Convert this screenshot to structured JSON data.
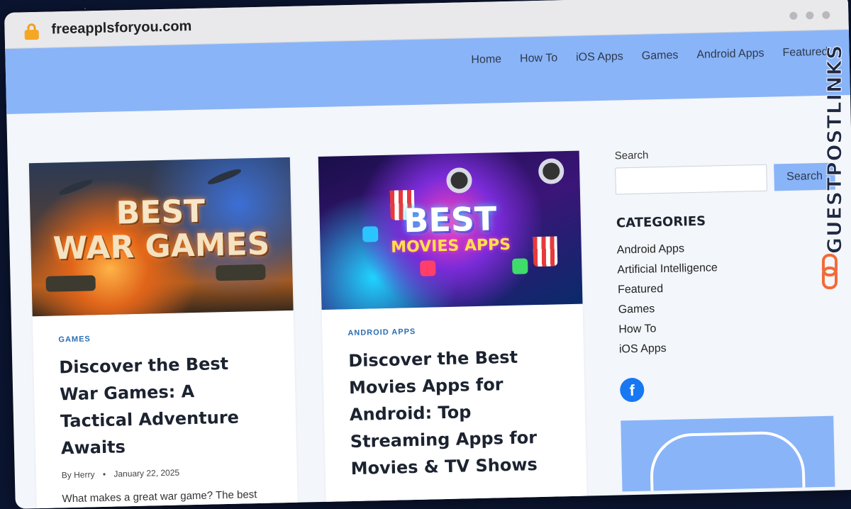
{
  "browser": {
    "url": "freeapplsforyou.com"
  },
  "nav": {
    "items": [
      "Home",
      "How To",
      "iOS Apps",
      "Games",
      "Android Apps",
      "Featured"
    ]
  },
  "posts": [
    {
      "image_text_line1": "BEST",
      "image_text_line2": "WAR GAMES",
      "category": "GAMES",
      "title": "Discover the Best War Games: A Tactical Adventure Awaits",
      "author_prefix": "By",
      "author": "Herry",
      "date": "January 22, 2025",
      "excerpt": "What makes a great war game? The best"
    },
    {
      "image_text_line1": "BEST",
      "image_text_line2": "MOVIES APPS",
      "category": "ANDROID APPS",
      "title": "Discover the Best Movies Apps for Android: Top Streaming Apps for Movies & TV Shows"
    }
  ],
  "sidebar": {
    "search_label": "Search",
    "search_button": "Search",
    "search_value": "",
    "categories_heading": "CATEGORIES",
    "categories": [
      "Android Apps",
      "Artificial Intelligence",
      "Featured",
      "Games",
      "How To",
      "iOS Apps"
    ],
    "social_icon": "facebook-icon"
  },
  "watermark": {
    "text": "GUESTPOSTLINKS"
  },
  "colors": {
    "header_bg": "#8ab4f8",
    "category_text": "#2a6db3",
    "facebook": "#1877f2",
    "watermark_accent": "#f26b3a"
  }
}
